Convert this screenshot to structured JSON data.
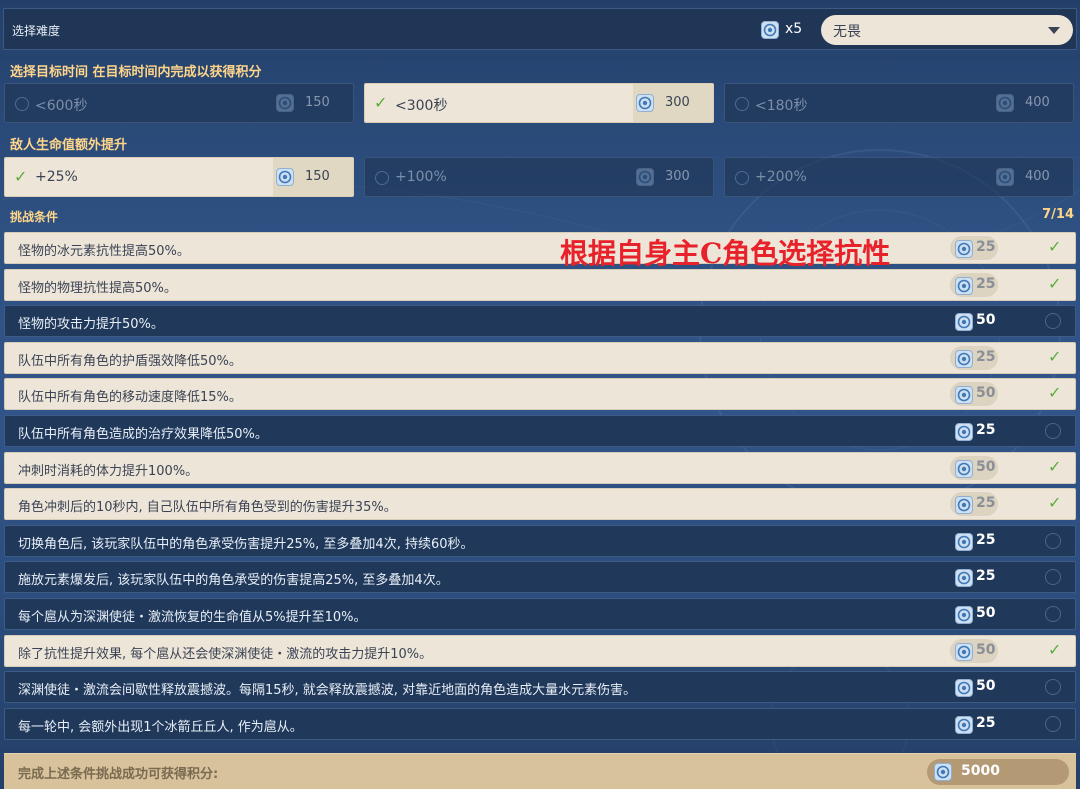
{
  "difficulty": {
    "label": "选择难度",
    "multiplier": "x5",
    "selected": "无畏"
  },
  "time_section": {
    "title": "选择目标时间 在目标时间内完成以获得积分",
    "options": [
      {
        "label": "<600秒",
        "points": "150",
        "selected": false
      },
      {
        "label": "<300秒",
        "points": "300",
        "selected": true
      },
      {
        "label": "<180秒",
        "points": "400",
        "selected": false
      }
    ]
  },
  "hp_section": {
    "title": "敌人生命值额外提升",
    "options": [
      {
        "label": "+25%",
        "points": "150",
        "selected": true
      },
      {
        "label": "+100%",
        "points": "300",
        "selected": false
      },
      {
        "label": "+200%",
        "points": "400",
        "selected": false
      }
    ]
  },
  "conditions": {
    "title": "挑战条件",
    "count": "7/14",
    "annotation": "根据自身主C角色选择抗性",
    "items": [
      {
        "text": "怪物的冰元素抗性提高50%。",
        "points": "25",
        "checked": true
      },
      {
        "text": "怪物的物理抗性提高50%。",
        "points": "25",
        "checked": true
      },
      {
        "text": "怪物的攻击力提升50%。",
        "points": "50",
        "checked": false
      },
      {
        "text": "队伍中所有角色的护盾强效降低50%。",
        "points": "25",
        "checked": true
      },
      {
        "text": "队伍中所有角色的移动速度降低15%。",
        "points": "50",
        "checked": true
      },
      {
        "text": "队伍中所有角色造成的治疗效果降低50%。",
        "points": "25",
        "checked": false
      },
      {
        "text": "冲刺时消耗的体力提升100%。",
        "points": "50",
        "checked": true
      },
      {
        "text": "角色冲刺后的10秒内, 自己队伍中所有角色受到的伤害提升35%。",
        "points": "25",
        "checked": true
      },
      {
        "text": "切换角色后, 该玩家队伍中的角色承受伤害提升25%, 至多叠加4次, 持续60秒。",
        "points": "25",
        "checked": false
      },
      {
        "text": "施放元素爆发后, 该玩家队伍中的角色承受的伤害提高25%, 至多叠加4次。",
        "points": "25",
        "checked": false
      },
      {
        "text": "每个扈从为深渊使徒・激流恢复的生命值从5%提升至10%。",
        "points": "50",
        "checked": false
      },
      {
        "text": "除了抗性提升效果, 每个扈从还会使深渊使徒・激流的攻击力提升10%。",
        "points": "50",
        "checked": true
      },
      {
        "text": "深渊使徒・激流会间歇性释放震撼波。每隔15秒, 就会释放震撼波, 对靠近地面的角色造成大量水元素伤害。",
        "points": "50",
        "checked": false
      },
      {
        "text": "每一轮中, 会额外出现1个冰箭丘丘人, 作为扈从。",
        "points": "25",
        "checked": false
      }
    ]
  },
  "footer": {
    "text": "完成上述条件挑战成功可获得积分:",
    "total": "5000"
  },
  "check_glyph": "✓",
  "icon_name": "score-point-icon"
}
